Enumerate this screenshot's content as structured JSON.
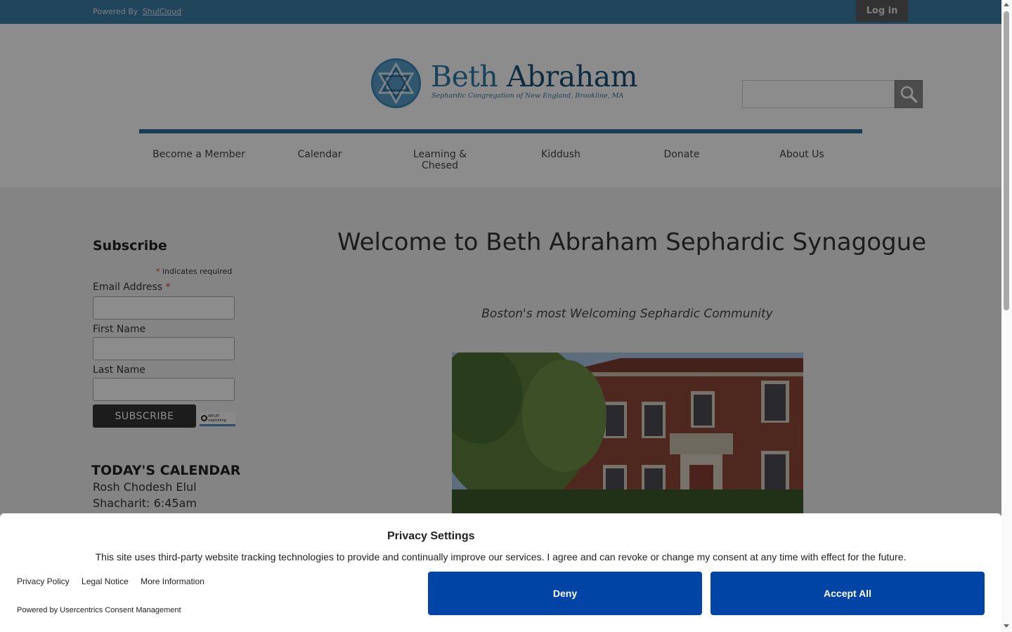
{
  "topbar": {
    "powered_by": "Powered By",
    "provider_link": "ShulCloud",
    "login_label": "Log in"
  },
  "logo": {
    "name_first": "Beth",
    "name_second": "Abraham",
    "tagline": "Sephardic Congregation of New England, Brookline, MA"
  },
  "search": {
    "placeholder": "",
    "icon": "search-icon"
  },
  "nav": {
    "items": [
      {
        "label": "Become a Member"
      },
      {
        "label": "Calendar"
      },
      {
        "label": "Learning & Chesed"
      },
      {
        "label": "Kiddush"
      },
      {
        "label": "Donate"
      },
      {
        "label": "About Us"
      }
    ]
  },
  "subscribe": {
    "title": "Subscribe",
    "required_mark": "*",
    "required_note": "indicates required",
    "email_label": "Email Address",
    "first_name_label": "First Name",
    "last_name_label": "Last Name",
    "submit_label": "SUBSCRIBE",
    "badge_line1": "INTUIT",
    "badge_line2": "mailchimp"
  },
  "calendar": {
    "title": "TODAY'S CALENDAR",
    "lines": [
      "Rosh Chodesh Elul",
      "Shacharit: 6:45am"
    ]
  },
  "main": {
    "welcome": "Welcome to Beth Abraham Sephardic Synagogue",
    "tagline": "Boston's most Welcoming Sephardic Community"
  },
  "consent": {
    "title": "Privacy Settings",
    "text": "This site uses third-party website tracking technologies to provide and continually improve our services. I agree and can revoke or change my consent at any time with effect for the future.",
    "links": [
      "Privacy Policy",
      "Legal Notice",
      "More Information"
    ],
    "powered_by": "Powered by Usercentrics Consent Management",
    "deny_label": "Deny",
    "accept_label": "Accept All"
  },
  "colors": {
    "topbar": "#3c7ea6",
    "accent_blue": "#0045a5",
    "logo_blue": "#2e7ba6"
  }
}
